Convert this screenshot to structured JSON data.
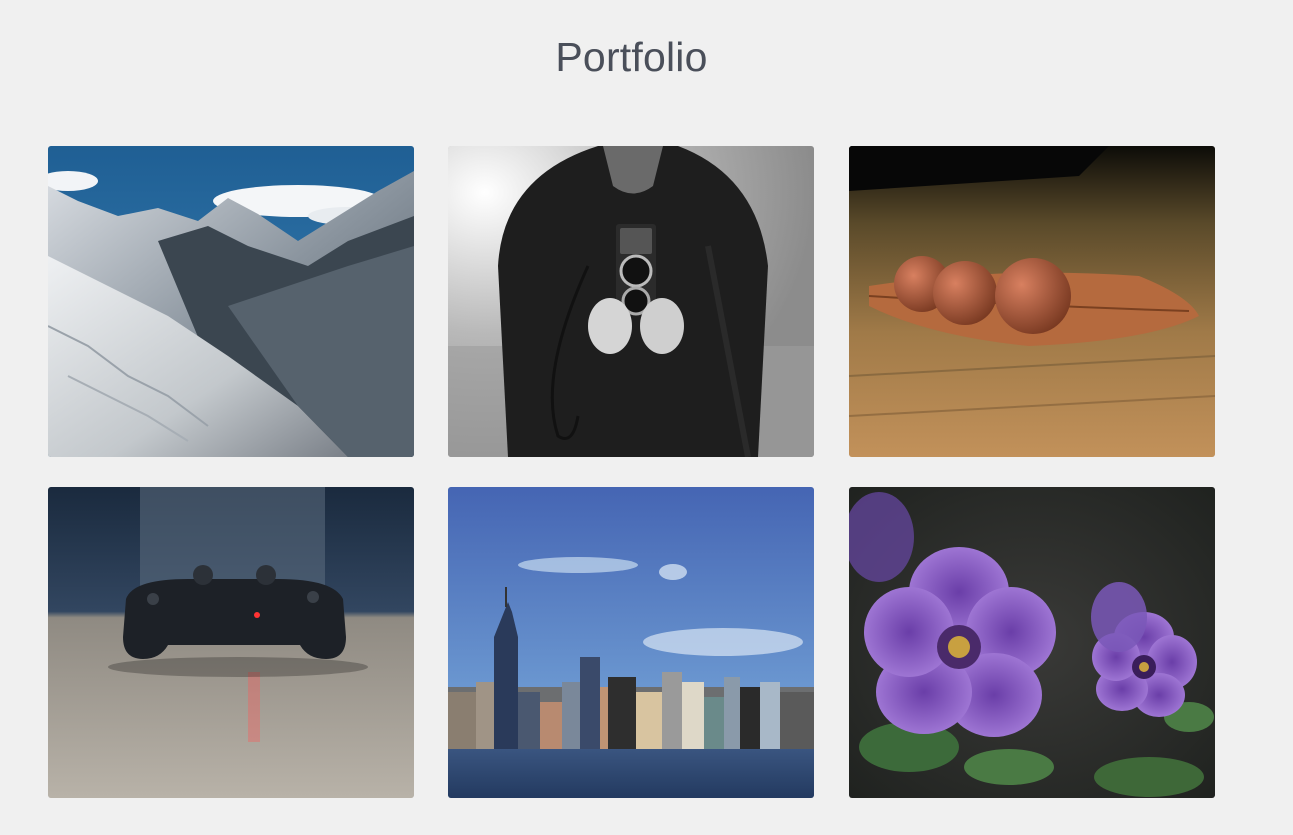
{
  "page": {
    "title": "Portfolio",
    "background": "#f0f0f0",
    "title_color": "#4a4f5a"
  },
  "gallery": {
    "items": [
      {
        "name": "mountains"
      },
      {
        "name": "vintage-camera"
      },
      {
        "name": "acorns-on-leaf"
      },
      {
        "name": "game-controller"
      },
      {
        "name": "city-skyline"
      },
      {
        "name": "purple-flowers"
      }
    ]
  }
}
